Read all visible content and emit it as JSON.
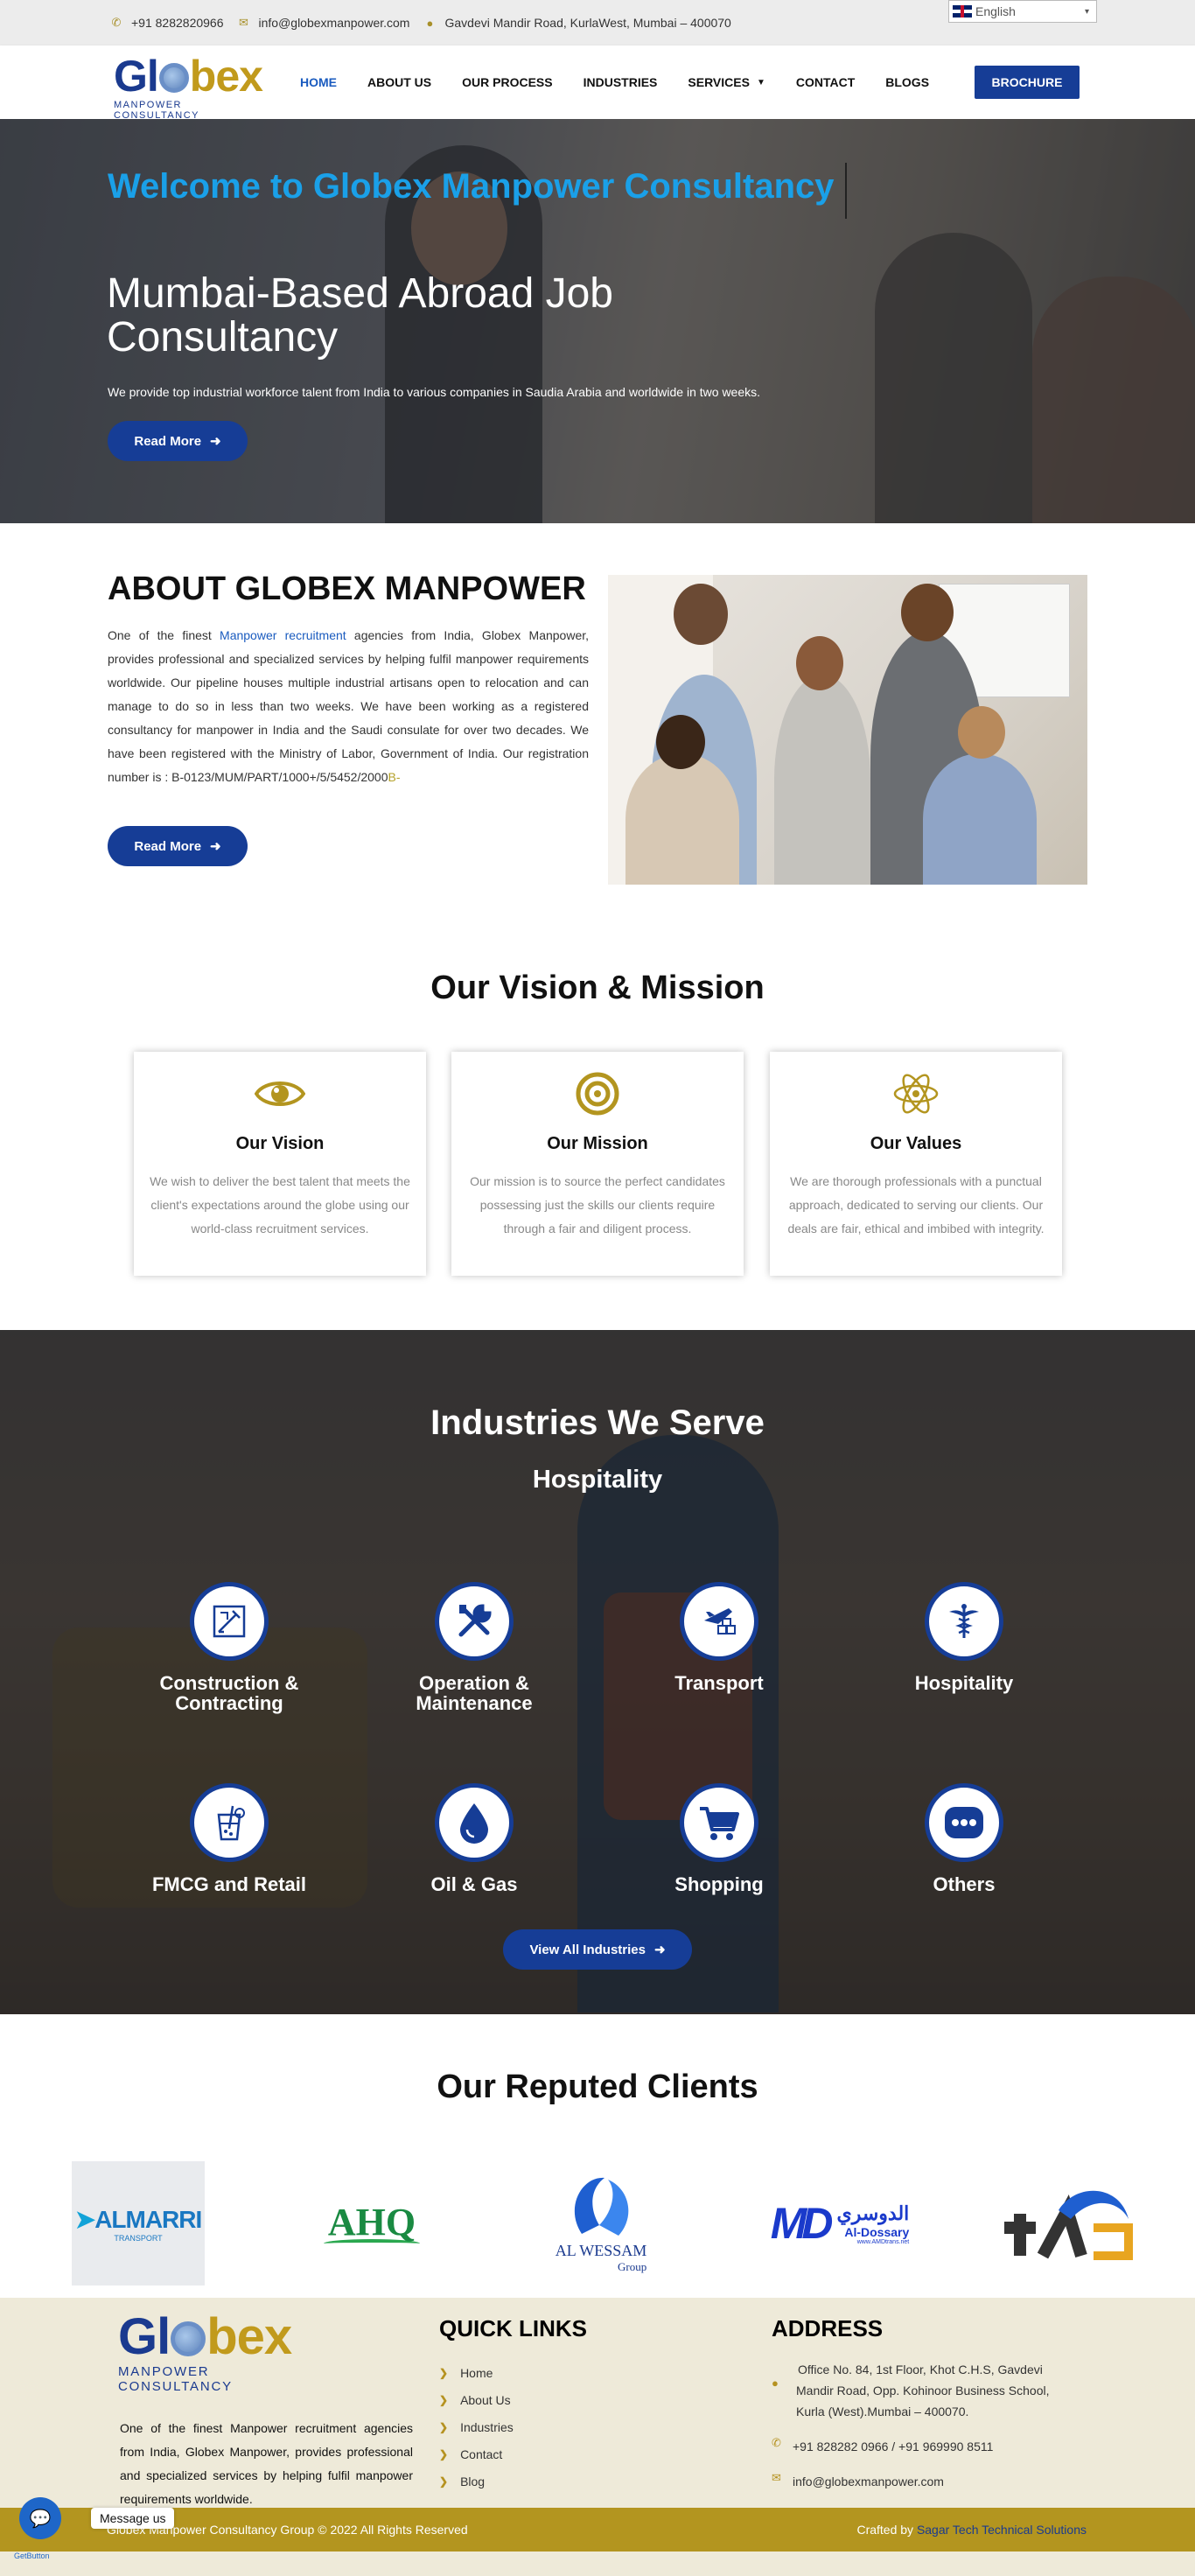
{
  "topbar": {
    "phone": "+91 8282820966",
    "email": "info@globexmanpower.com",
    "address": "Gavdevi Mandir Road, KurlaWest, Mumbai – 400070",
    "language": "English"
  },
  "logo": {
    "word_a": "Gl",
    "word_b": "bex",
    "subtitle": "MANPOWER CONSULTANCY"
  },
  "nav": {
    "items": [
      "HOME",
      "ABOUT US",
      "OUR PROCESS",
      "INDUSTRIES",
      "SERVICES",
      "CONTACT",
      "BLOGS"
    ],
    "brochure": "BROCHURE"
  },
  "hero": {
    "welcome": "Welcome to Globex Manpower Consultancy",
    "title": "Mumbai-Based Abroad Job Consultancy",
    "description": "We provide top industrial workforce talent from India to various companies in Saudia Arabia and worldwide in two weeks.",
    "button": "Read More"
  },
  "about": {
    "heading": "ABOUT GLOBEX MANPOWER",
    "text_before": "One of the finest ",
    "link_text": "Manpower recruitment",
    "text_after": " agencies from India, Globex Manpower, provides professional and specialized services by helping fulfil manpower requirements worldwide. Our pipeline houses multiple industrial artisans open to relocation and can manage to do so in less than two weeks. We have been working as a registered consultancy for manpower in India and the Saudi consulate for over two decades. We have been registered with the Ministry of Labor, Government of India. Our registration number is : B-0123/MUM/PART/1000+/5/5452/2000",
    "text_tail": "B-",
    "button": "Read More"
  },
  "vision": {
    "heading": "Our Vision & Mission",
    "cards": [
      {
        "title": "Our Vision",
        "text": "We wish to deliver the best talent that meets the client's expectations around the globe using our world-class recruitment services.",
        "icon": "eye-icon"
      },
      {
        "title": "Our Mission",
        "text": "Our mission is to source the perfect candidates possessing just the skills our clients require through a fair and diligent process.",
        "icon": "target-icon"
      },
      {
        "title": "Our Values",
        "text": "We are thorough professionals with a punctual approach, dedicated to serving our clients. Our deals are fair, ethical and imbibed with integrity.",
        "icon": "atom-icon"
      }
    ]
  },
  "industries": {
    "heading": "Industries We Serve",
    "subheading": "Hospitality",
    "items": [
      {
        "label": "Construction & Contracting",
        "icon": "blueprint-icon"
      },
      {
        "label": "Operation & Maintenance",
        "icon": "tools-icon"
      },
      {
        "label": "Transport",
        "icon": "transport-icon"
      },
      {
        "label": "Hospitality",
        "icon": "caduceus-icon"
      },
      {
        "label": "FMCG and Retail",
        "icon": "drink-icon"
      },
      {
        "label": "Oil & Gas",
        "icon": "drop-icon"
      },
      {
        "label": "Shopping",
        "icon": "cart-icon"
      },
      {
        "label": "Others",
        "icon": "more-icon"
      }
    ],
    "button": "View All Industries"
  },
  "clients": {
    "heading": "Our Reputed Clients",
    "logos": [
      {
        "name": "ALMARRI",
        "sub": "TRANSPORT"
      },
      {
        "name": "AHQ",
        "sub": ""
      },
      {
        "name": "AL WESSAM",
        "sub": "Group"
      },
      {
        "name": "الدوسري",
        "sub": "Al-Dossary",
        "url": "www.AMDtrans.net"
      },
      {
        "name": "TLA",
        "sub": ""
      }
    ]
  },
  "footer": {
    "description": "One of the finest Manpower recruitment agencies from India, Globex Manpower, provides professional and specialized services by helping fulfil manpower requirements worldwide.",
    "quick_links_title": "QUICK LINKS",
    "quick_links": [
      "Home",
      "About Us",
      "Industries",
      "Contact",
      "Blog"
    ],
    "address_title": "ADDRESS",
    "address": "Office No. 84, 1st Floor, Khot C.H.S, Gavdevi Mandir Road, Opp. Kohinoor Business School, Kurla (West).Mumbai – 400070.",
    "phones": "+91 828282 0966 / +91 969990 8511",
    "email": "info@globexmanpower.com",
    "copyright": "Globex Manpower Consultancy Group © 2022 All Rights Reserved",
    "crafted_by_prefix": "Crafted by ",
    "crafted_by": "Sagar Tech Technical Solutions"
  },
  "chat": {
    "label": "Message us",
    "powered": "GetButton"
  },
  "colors": {
    "primary": "#163d96",
    "gold": "#b3951f",
    "welcome": "#1aa0e8",
    "footer_bg": "#eeead9"
  }
}
